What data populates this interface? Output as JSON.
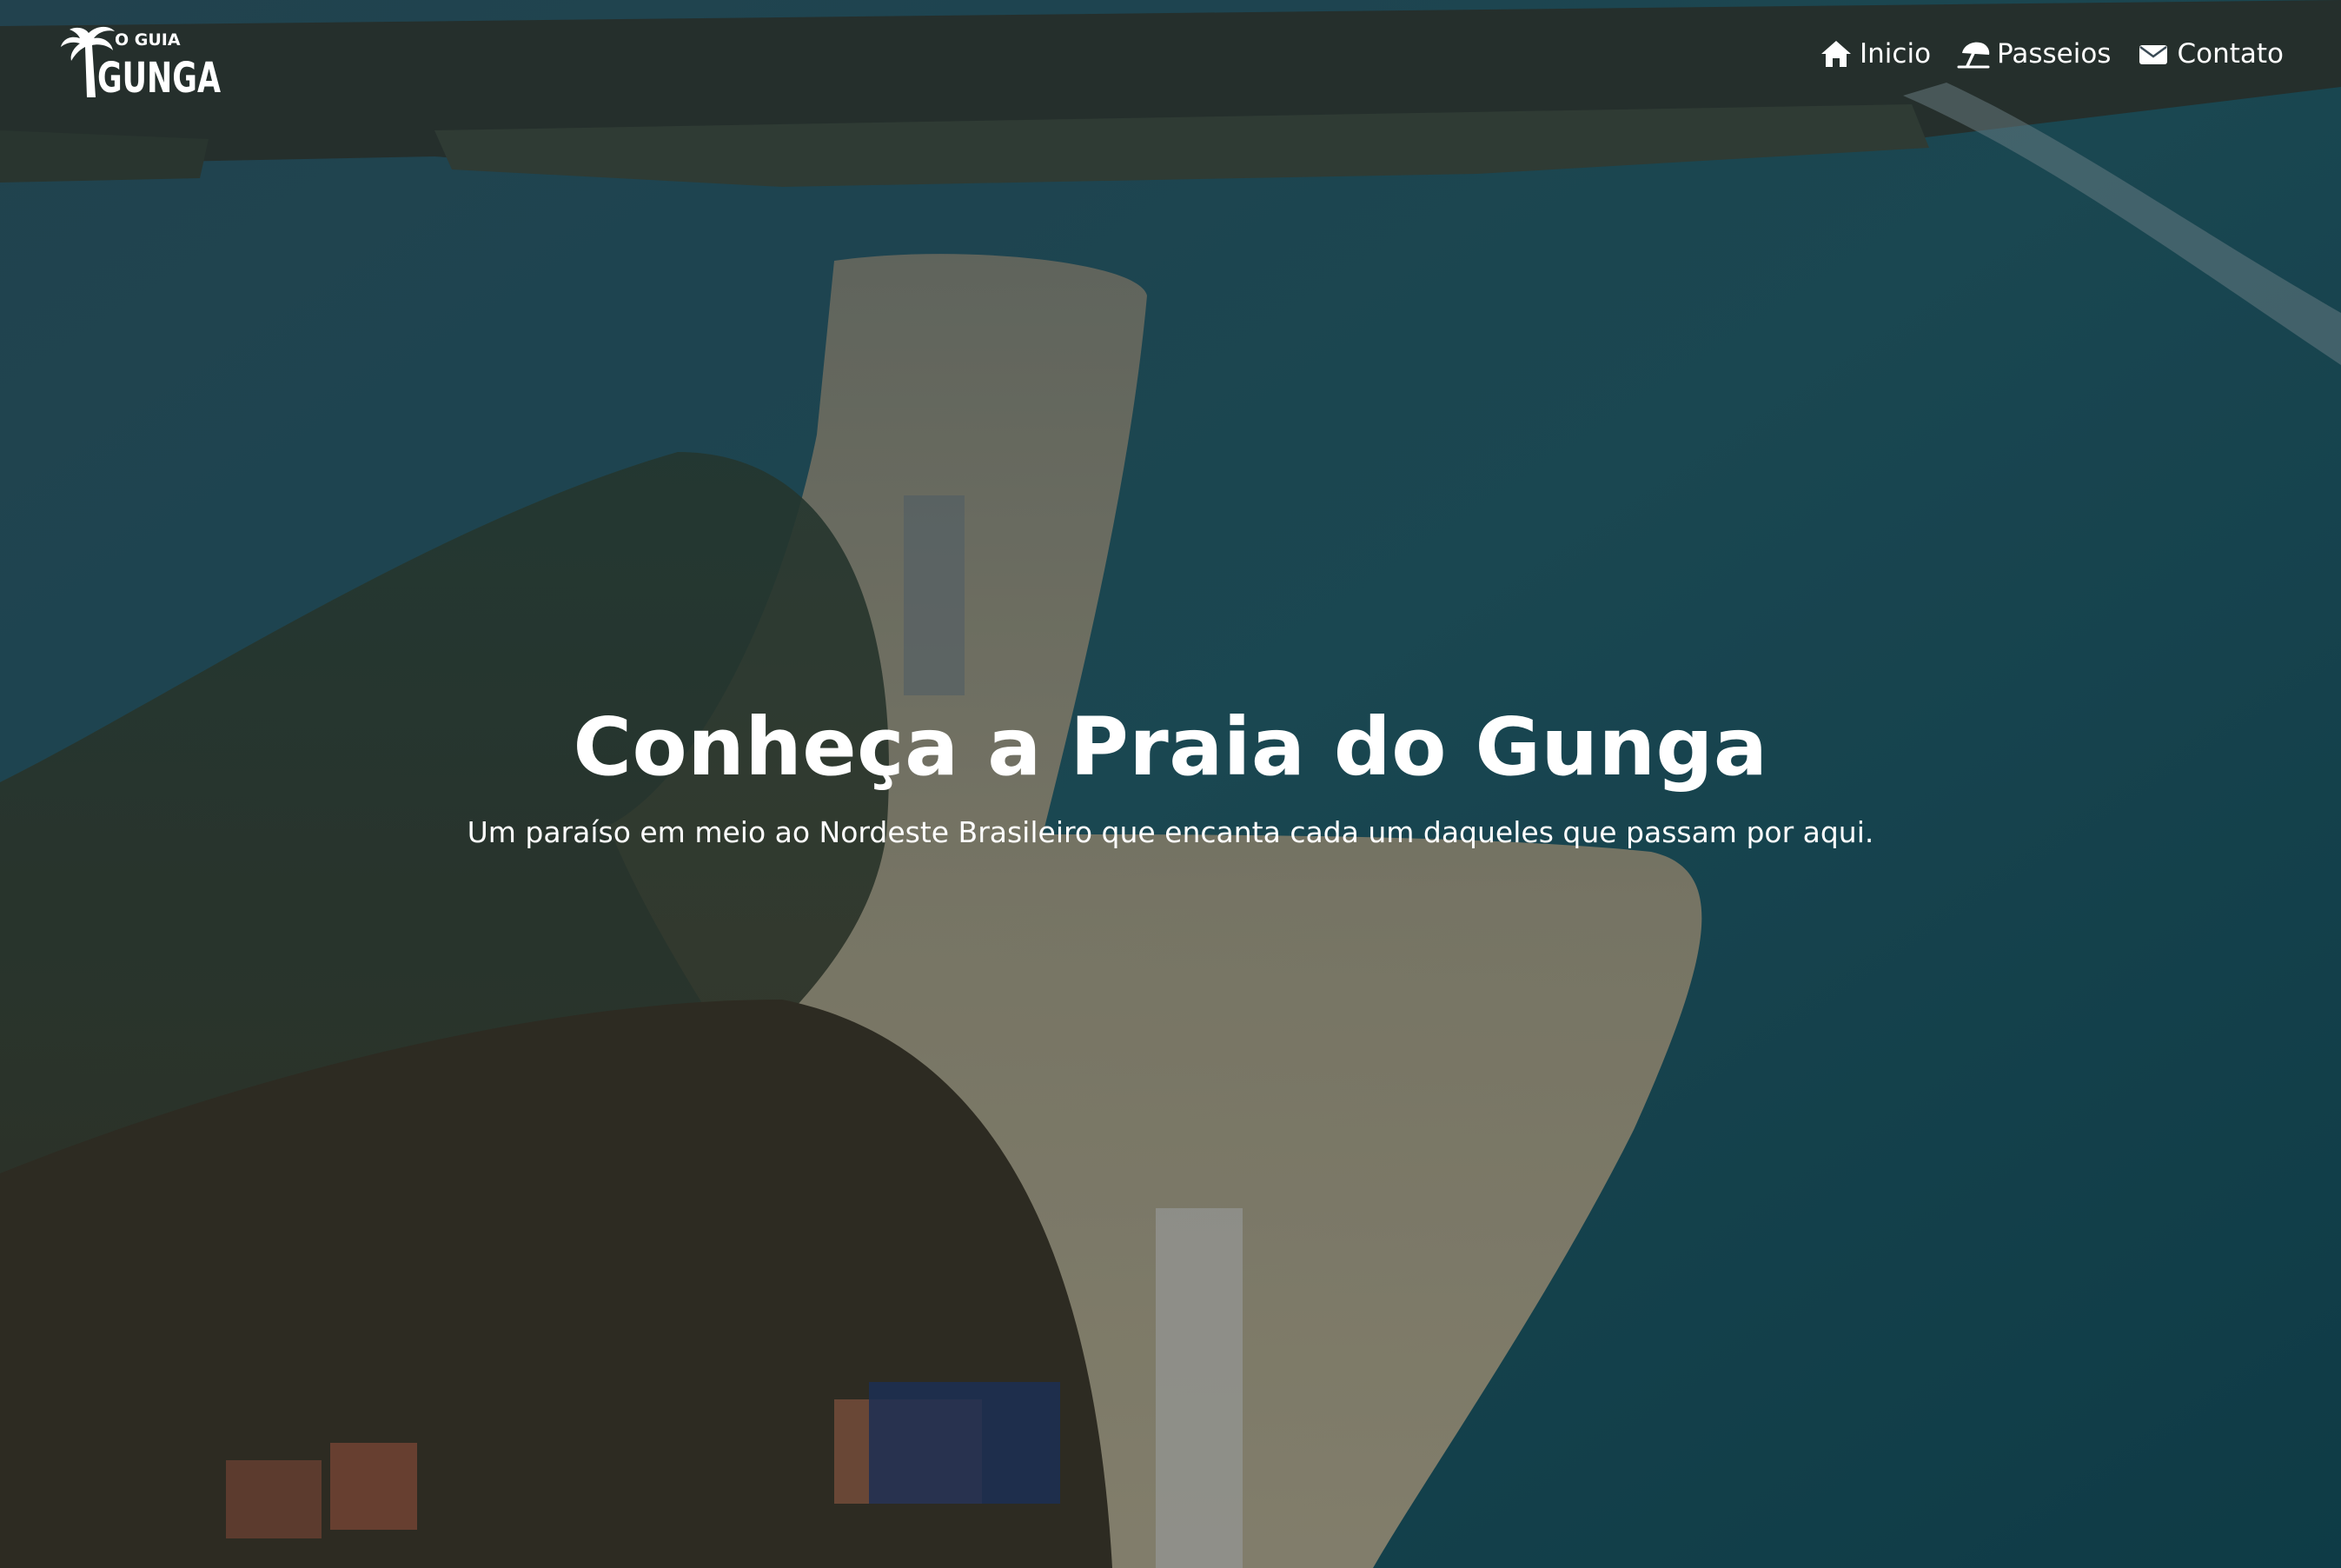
{
  "nav": {
    "logo": {
      "small_text": "O GUIA",
      "main_text": "GUNGA"
    },
    "items": [
      {
        "label": "Inicio",
        "icon": "home-icon"
      },
      {
        "label": "Passeios",
        "icon": "beach-umbrella-icon"
      },
      {
        "label": "Contato",
        "icon": "envelope-icon"
      }
    ]
  },
  "hero": {
    "title": "Conheça a Praia do Gunga",
    "subtitle": "Um paraíso em meio ao Nordeste Brasileiro que encanta cada um daqueles que passam por aqui."
  },
  "colors": {
    "sea": "#1f5862",
    "sand": "#c8b48f",
    "overlay": "#0f141c",
    "text": "#ffffff"
  }
}
